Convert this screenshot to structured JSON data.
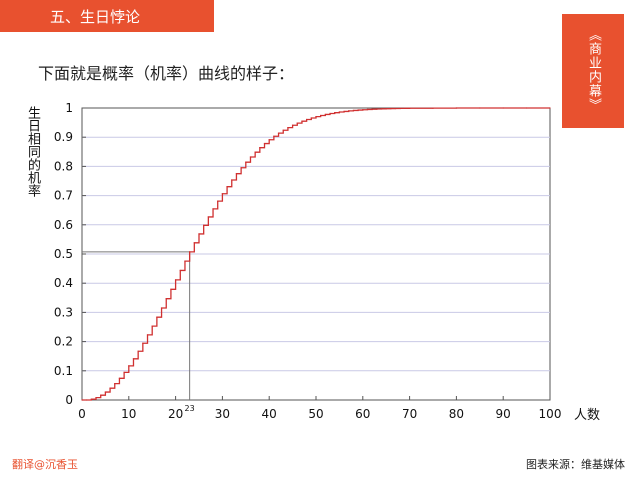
{
  "header": {
    "section_title": "五、生日悖论"
  },
  "side_tag": {
    "text": "《商业内幕》"
  },
  "subtitle": "下面就是概率（机率）曲线的样子：",
  "footer": {
    "left": "翻译@沉香玉",
    "right": "图表来源：维基媒体"
  },
  "colors": {
    "accent": "#e8512f",
    "curve": "#d03030",
    "grid": "#c9c9e6"
  },
  "chart_data": {
    "type": "line",
    "step": true,
    "xlabel": "人数",
    "ylabel": "生日相同的机率",
    "xlim": [
      0,
      100
    ],
    "ylim": [
      0,
      1
    ],
    "xticks": [
      "0",
      "10",
      "20",
      "30",
      "40",
      "50",
      "60",
      "70",
      "80",
      "90",
      "100"
    ],
    "yticks": [
      "0",
      "0.1",
      "0.2",
      "0.3",
      "0.4",
      "0.5",
      "0.6",
      "0.7",
      "0.8",
      "0.9",
      "1"
    ],
    "grid": true,
    "annotation": {
      "x": 23,
      "y": 0.5073,
      "label": "23"
    },
    "series": [
      {
        "x": [
          0,
          1,
          2,
          3,
          4,
          5,
          6,
          7,
          8,
          9,
          10,
          11,
          12,
          13,
          14,
          15,
          16,
          17,
          18,
          19,
          20,
          21,
          22,
          23,
          24,
          25,
          26,
          27,
          28,
          29,
          30,
          31,
          32,
          33,
          34,
          35,
          36,
          37,
          38,
          39,
          40,
          41,
          42,
          43,
          44,
          45,
          46,
          47,
          48,
          49,
          50,
          51,
          52,
          53,
          54,
          55,
          56,
          57,
          58,
          59,
          60,
          61,
          62,
          63,
          64,
          65,
          66,
          67,
          68,
          69,
          70,
          75,
          80,
          85,
          90,
          95,
          100
        ],
        "y": [
          0,
          0,
          0.0027,
          0.0082,
          0.0164,
          0.0271,
          0.0405,
          0.0562,
          0.0743,
          0.0946,
          0.1169,
          0.1411,
          0.167,
          0.1944,
          0.2231,
          0.2529,
          0.2836,
          0.315,
          0.3469,
          0.3791,
          0.4114,
          0.4437,
          0.4757,
          0.5073,
          0.5383,
          0.5687,
          0.5982,
          0.6269,
          0.6545,
          0.681,
          0.7063,
          0.7305,
          0.7533,
          0.775,
          0.7953,
          0.8144,
          0.8322,
          0.8487,
          0.8641,
          0.8782,
          0.8912,
          0.9032,
          0.914,
          0.9239,
          0.9329,
          0.941,
          0.9483,
          0.9548,
          0.9606,
          0.9658,
          0.9704,
          0.9744,
          0.978,
          0.9811,
          0.9839,
          0.9863,
          0.9883,
          0.9901,
          0.9917,
          0.993,
          0.9941,
          0.9951,
          0.9959,
          0.9966,
          0.9972,
          0.9977,
          0.9981,
          0.9984,
          0.9987,
          0.999,
          0.9992,
          0.9997,
          0.9999,
          1.0,
          1.0,
          1.0,
          1.0
        ]
      }
    ]
  }
}
